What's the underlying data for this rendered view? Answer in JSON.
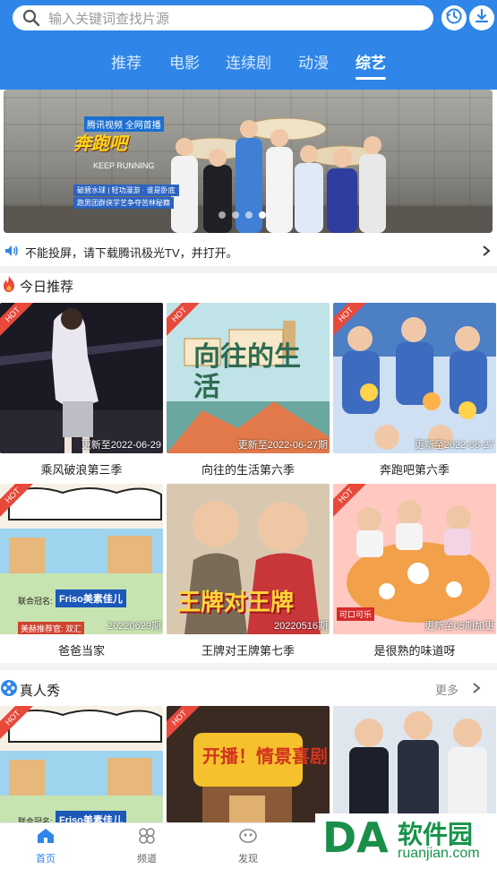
{
  "header": {
    "search_placeholder": "输入关键词查找片源",
    "history_icon": "history-icon",
    "download_icon": "download-icon",
    "tabs": [
      {
        "label": "推荐",
        "active": false
      },
      {
        "label": "电影",
        "active": false
      },
      {
        "label": "连续剧",
        "active": false
      },
      {
        "label": "动漫",
        "active": false
      },
      {
        "label": "综艺",
        "active": true
      }
    ]
  },
  "banner": {
    "logo_title": "奔跑吧",
    "logo_small": "腾讯视频 全网首播",
    "logo_sub": "KEEP RUNNING",
    "logo_lines": [
      "破碧水球 | 轻功漫游 · 谁是卧底",
      "跑男团群侠学艺争夺苦林秘籍"
    ],
    "badge": "全网首播",
    "dots": 4,
    "active_dot": 3
  },
  "notice": {
    "text": "不能投屏，请下载腾讯极光TV，并打开。"
  },
  "today": {
    "title": "今日推荐",
    "items": [
      {
        "title": "乘风破浪第三季",
        "update": "更新至2022-06-29",
        "badge": "HOT"
      },
      {
        "title": "向往的生活第六季",
        "update": "更新至2022-06-27期",
        "badge": "HOT"
      },
      {
        "title": "奔跑吧第六季",
        "update": "更新至2022-06-27",
        "badge": "HOT"
      },
      {
        "title": "爸爸当家",
        "update": "20220629期",
        "badge": "HOT"
      },
      {
        "title": "王牌对王牌第七季",
        "update": "20220516期",
        "badge": "HOT"
      },
      {
        "title": "是很熟的味道呀",
        "update": "更新至05期加更",
        "badge": "HOT"
      }
    ]
  },
  "reality": {
    "title": "真人秀",
    "more": "更多",
    "items": [
      {
        "badge": "HOT"
      },
      {
        "badge": "HOT"
      },
      {
        "badge": ""
      }
    ]
  },
  "thumb_text": {
    "baba_sponsor": "联合冠名:",
    "baba_brand": "Friso美素佳儿",
    "baba_extra": "美赫推荐官: 双汇",
    "wangpai": "王牌对王牌",
    "xiangwang": "向往的生活",
    "kaibo": "开播！情景喜剧",
    "kekou": "可口可乐"
  },
  "bottom_nav": [
    {
      "label": "首页",
      "active": true
    },
    {
      "label": "频道",
      "active": false
    },
    {
      "label": "发现",
      "active": false
    }
  ],
  "watermark": {
    "logo": "DA",
    "cn": "软件园",
    "en": "ruanjian.com"
  },
  "colors": {
    "brand_blue": "#2f86e8",
    "hot_red": "#e8493a",
    "watermark_green": "#17944a"
  }
}
